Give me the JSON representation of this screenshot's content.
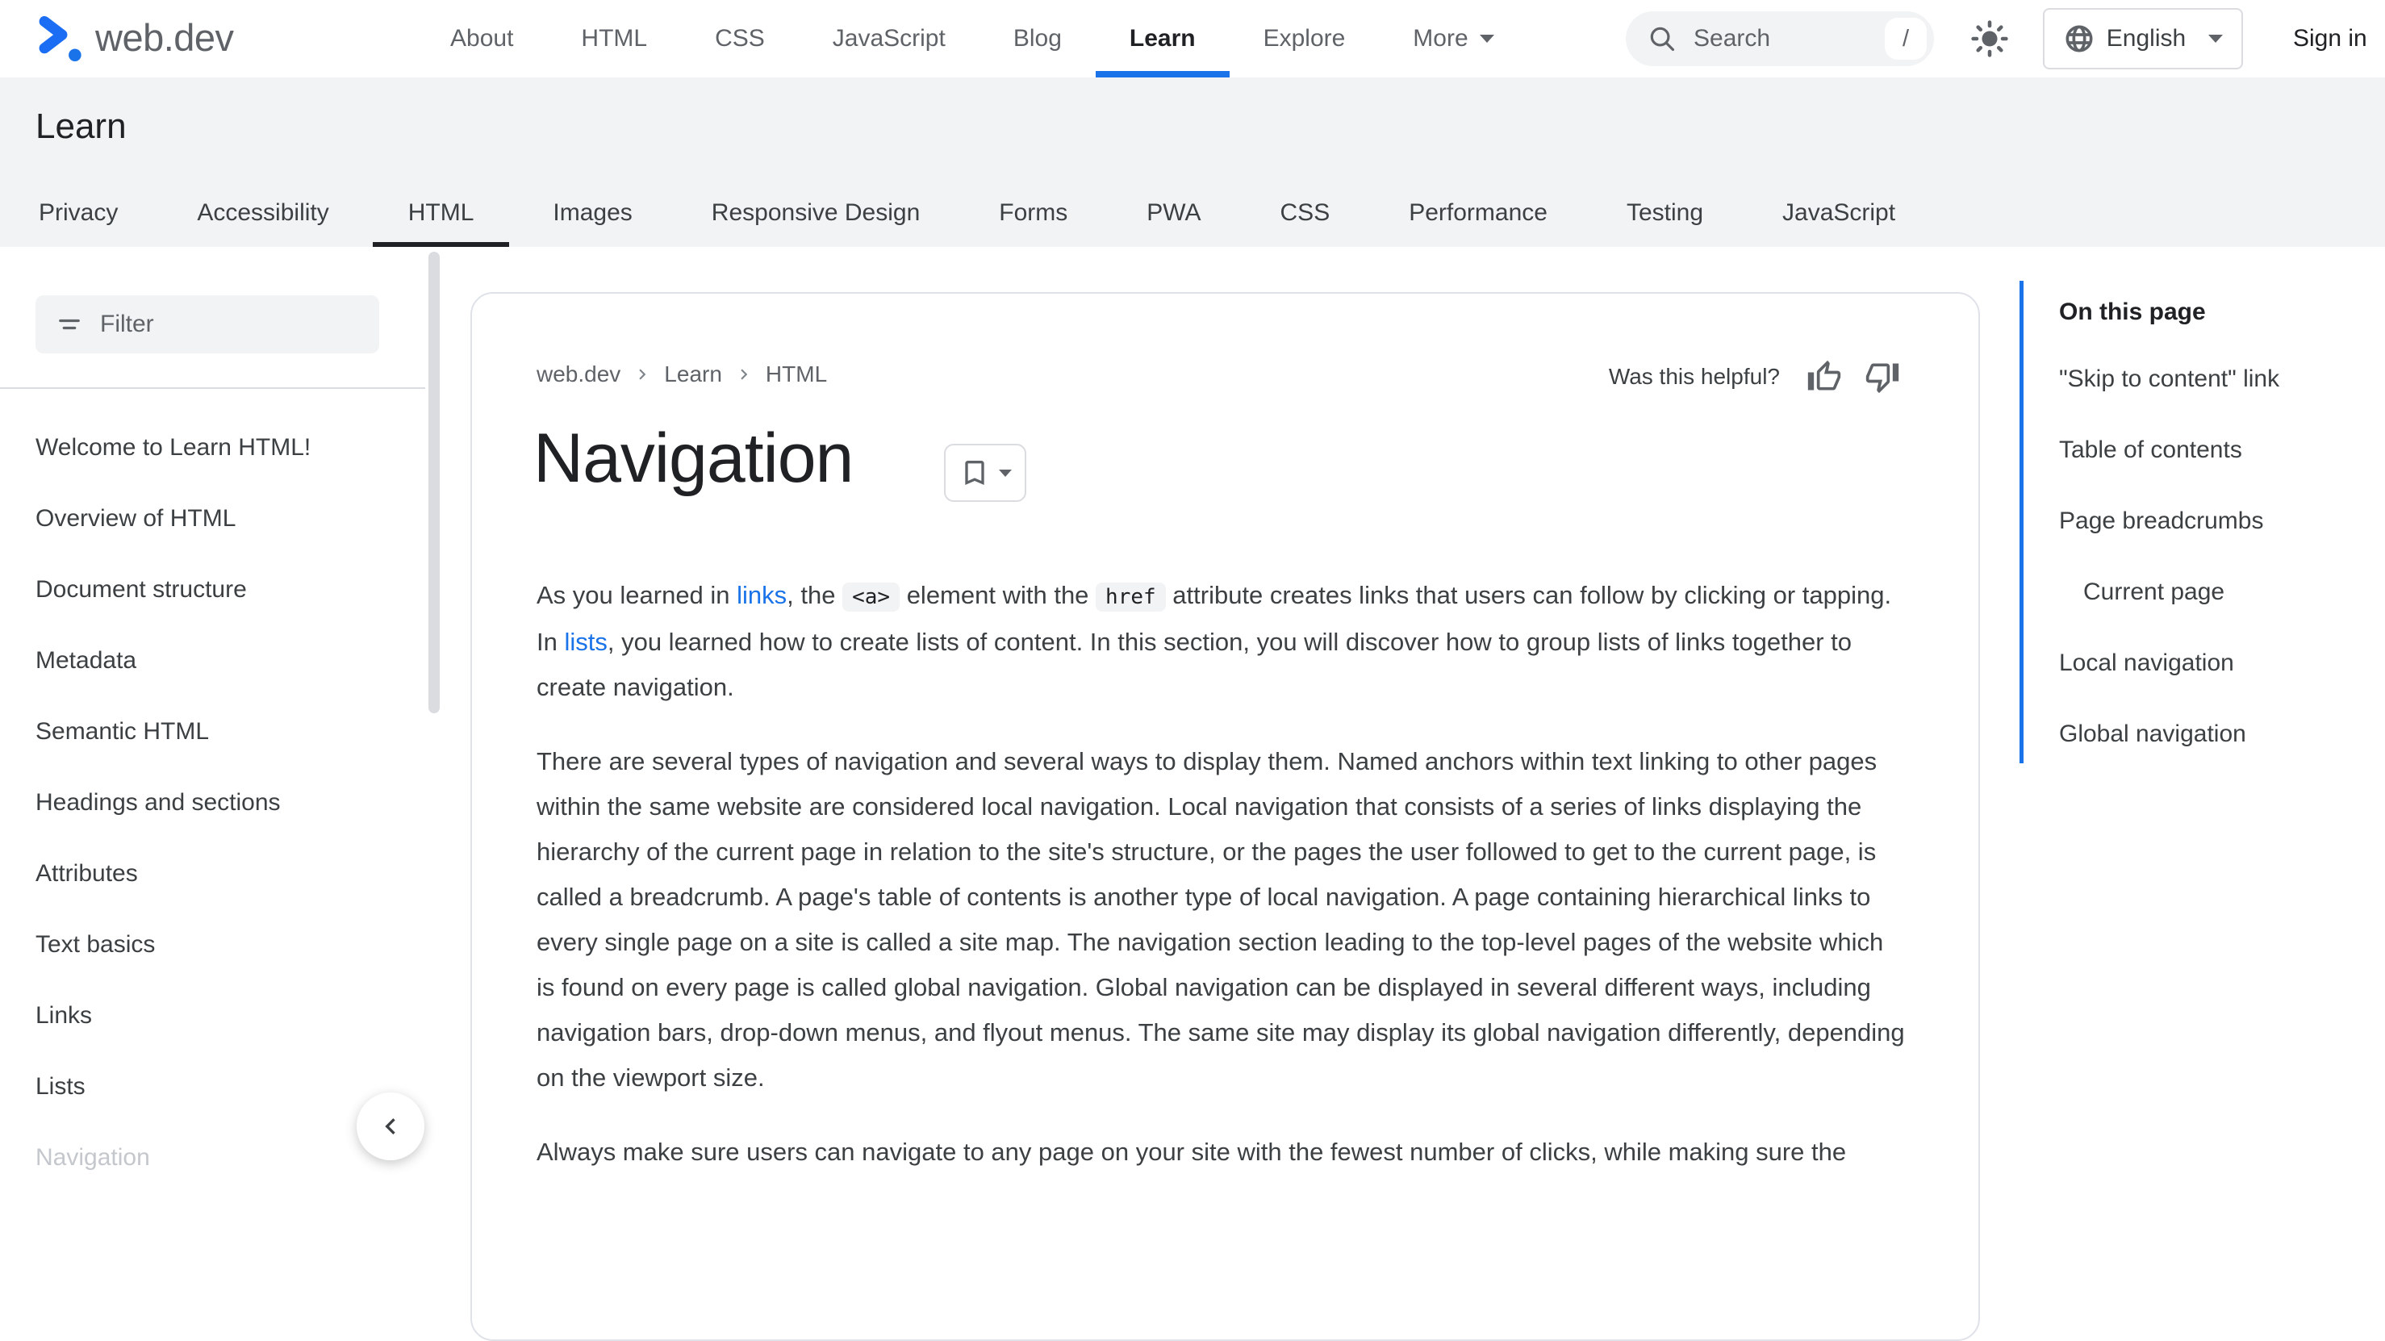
{
  "colors": {
    "accent_blue": "#1a73e8",
    "text_primary": "#202124",
    "text_secondary": "#5f6368",
    "surface_gray": "#f1f3f4",
    "border_gray": "#dadce0",
    "logo_purple": "#c06cf0",
    "logo_light_blue": "#7fc8f8"
  },
  "header": {
    "logo_text": "web.dev",
    "nav": [
      "About",
      "HTML",
      "CSS",
      "JavaScript",
      "Blog",
      "Learn",
      "Explore",
      "More"
    ],
    "active_nav": "Learn",
    "search": {
      "placeholder": "Search",
      "shortcut": "/"
    },
    "language": "English",
    "sign_in": "Sign in"
  },
  "learn_band": {
    "title": "Learn",
    "tabs": [
      "Privacy",
      "Accessibility",
      "HTML",
      "Images",
      "Responsive Design",
      "Forms",
      "PWA",
      "CSS",
      "Performance",
      "Testing",
      "JavaScript"
    ],
    "active_tab": "HTML"
  },
  "sidebar": {
    "filter_placeholder": "Filter",
    "items": [
      "Welcome to Learn HTML!",
      "Overview of HTML",
      "Document structure",
      "Metadata",
      "Semantic HTML",
      "Headings and sections",
      "Attributes",
      "Text basics",
      "Links",
      "Lists",
      "Navigation"
    ]
  },
  "article": {
    "breadcrumb": [
      "web.dev",
      "Learn",
      "HTML"
    ],
    "helpful_label": "Was this helpful?",
    "title": "Navigation",
    "paragraph1_segments": [
      {
        "t": "text",
        "v": "As you learned in "
      },
      {
        "t": "link",
        "v": "links"
      },
      {
        "t": "text",
        "v": ", the "
      },
      {
        "t": "code",
        "v": "<a>"
      },
      {
        "t": "text",
        "v": " element with the "
      },
      {
        "t": "code",
        "v": "href"
      },
      {
        "t": "text",
        "v": " attribute creates links that users can follow by clicking or tapping. In "
      },
      {
        "t": "link",
        "v": "lists"
      },
      {
        "t": "text",
        "v": ", you learned how to create lists of content. In this section, you will discover how to group lists of links together to create navigation."
      }
    ],
    "paragraph2": "There are several types of navigation and several ways to display them. Named anchors within text linking to other pages within the same website are considered local navigation. Local navigation that consists of a series of links displaying the hierarchy of the current page in relation to the site's structure, or the pages the user followed to get to the current page, is called a breadcrumb. A page's table of contents is another type of local navigation. A page containing hierarchical links to every single page on a site is called a site map. The navigation section leading to the top-level pages of the website which is found on every page is called global navigation. Global navigation can be displayed in several different ways, including navigation bars, drop-down menus, and flyout menus. The same site may display its global navigation differently, depending on the viewport size.",
    "paragraph3": "Always make sure users can navigate to any page on your site with the fewest number of clicks, while making sure the"
  },
  "toc": {
    "heading": "On this page",
    "items": [
      "\"Skip to content\" link",
      "Table of contents",
      "Page breadcrumbs",
      "Current page",
      "Local navigation",
      "Global navigation"
    ]
  }
}
